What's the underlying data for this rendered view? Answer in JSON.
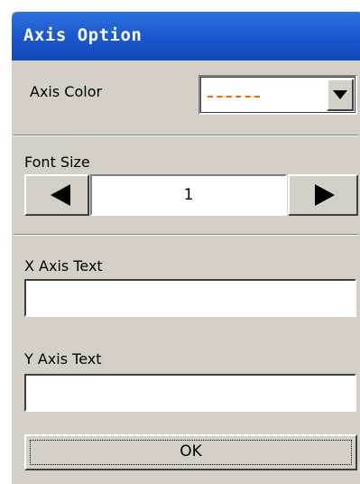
{
  "window": {
    "title": "Axis Option"
  },
  "axis_color": {
    "label": "Axis Color",
    "selected_color": "#ff6000",
    "dropdown_icon": "triangle-down-icon"
  },
  "font_size": {
    "label": "Font Size",
    "value": "1",
    "decrement_icon": "triangle-left-icon",
    "increment_icon": "triangle-right-icon"
  },
  "x_axis_text": {
    "label": "X Axis Text",
    "value": ""
  },
  "y_axis_text": {
    "label": "Y Axis Text",
    "value": ""
  },
  "ok_button": {
    "label": "OK"
  },
  "colors": {
    "titlebar": "#1c5bd2",
    "panel": "#d4d0c8"
  }
}
